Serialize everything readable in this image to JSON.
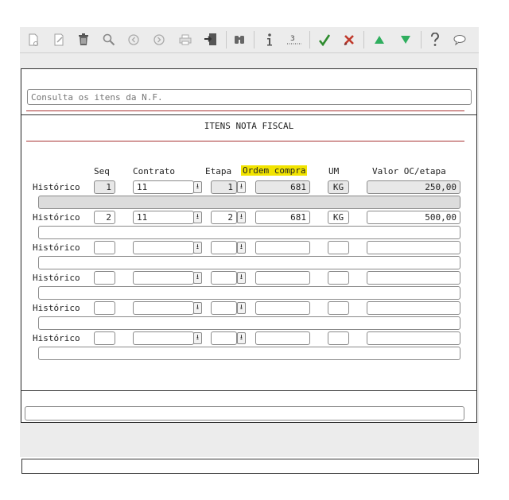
{
  "toolbar": {
    "buttons": [
      "new-doc-icon",
      "edit-icon",
      "trash-icon",
      "search-icon",
      "previous-icon",
      "next-icon",
      "print-icon",
      "export-icon",
      "binoculars-icon",
      "info-icon",
      "ruler-icon",
      "confirm-icon",
      "cancel-icon",
      "up-icon",
      "down-icon",
      "help-icon",
      "comment-icon"
    ]
  },
  "search": {
    "placeholder": "Consulta os itens da N.F."
  },
  "form": {
    "title": "ITENS NOTA FISCAL",
    "headers": {
      "seq": "Seq",
      "contrato": "Contrato",
      "etapa": "Etapa",
      "ordem": "Ordem compra",
      "um": "UM",
      "valor": "Valor OC/etapa"
    },
    "row_label": "Histórico",
    "dropdown_glyph": "⭳",
    "rows": [
      {
        "seq": "1",
        "contrato": "11",
        "etapa": "1",
        "ordem": "681",
        "um": "KG",
        "valor": "250,00",
        "historico": ""
      },
      {
        "seq": "2",
        "contrato": "11",
        "etapa": "2",
        "ordem": "681",
        "um": "KG",
        "valor": "500,00",
        "historico": ""
      },
      {
        "seq": "",
        "contrato": "",
        "etapa": "",
        "ordem": "",
        "um": "",
        "valor": "",
        "historico": ""
      },
      {
        "seq": "",
        "contrato": "",
        "etapa": "",
        "ordem": "",
        "um": "",
        "valor": "",
        "historico": ""
      },
      {
        "seq": "",
        "contrato": "",
        "etapa": "",
        "ordem": "",
        "um": "",
        "valor": "",
        "historico": ""
      },
      {
        "seq": "",
        "contrato": "",
        "etapa": "",
        "ordem": "",
        "um": "",
        "valor": "",
        "historico": ""
      }
    ]
  },
  "bottom": {
    "message": ""
  },
  "status": {
    "text": ""
  },
  "colors": {
    "highlight": "#f2e400",
    "accent_red": "#a83232",
    "confirm_green": "#2e8b2e",
    "cancel_red": "#c0392b"
  }
}
